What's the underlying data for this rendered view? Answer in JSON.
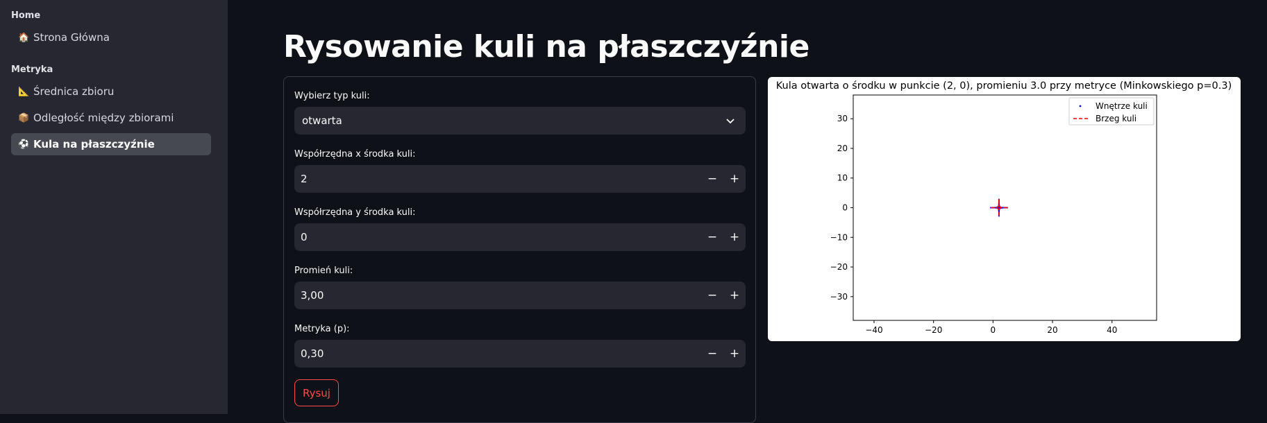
{
  "sidebar": {
    "sections": [
      {
        "heading": "Home",
        "items": [
          {
            "icon": "🏠",
            "label": "Strona Główna"
          }
        ]
      },
      {
        "heading": "Metryka",
        "items": [
          {
            "icon": "📐",
            "label": "Średnica zbioru"
          },
          {
            "icon": "📦",
            "label": "Odległość między zbiorami"
          },
          {
            "icon": "⚽",
            "label": "Kula na płaszczyźnie",
            "active": true
          }
        ]
      }
    ]
  },
  "page": {
    "title": "Rysowanie kuli na płaszczyźnie"
  },
  "form": {
    "type_label": "Wybierz typ kuli:",
    "type_value": "otwarta",
    "x_label": "Współrzędna x środka kuli:",
    "x_value": "2",
    "y_label": "Współrzędna y środka kuli:",
    "y_value": "0",
    "r_label": "Promień kuli:",
    "r_value": "3,00",
    "p_label": "Metryka (p):",
    "p_value": "0,30",
    "minus": "−",
    "plus": "+",
    "submit_label": "Rysuj"
  },
  "chart_data": {
    "type": "scatter",
    "title": "Kula otwarta o środku w punkcie (2, 0), promieniu 3.0 przy metryce (Minkowskiego p=0.3)",
    "center": [
      2,
      0
    ],
    "radius": 3.0,
    "p": 0.3,
    "xlim": [
      -47,
      55
    ],
    "ylim": [
      -38,
      38
    ],
    "xticks": [
      -40,
      -20,
      0,
      20,
      40
    ],
    "yticks": [
      30,
      20,
      10,
      0,
      -10,
      -20,
      -30
    ],
    "series": [
      {
        "name": "Wnętrze kuli",
        "style": "points",
        "color": "#0000ff"
      },
      {
        "name": "Brzeg kuli",
        "style": "dashed",
        "color": "#ff0000"
      }
    ],
    "legend": "top-right"
  }
}
